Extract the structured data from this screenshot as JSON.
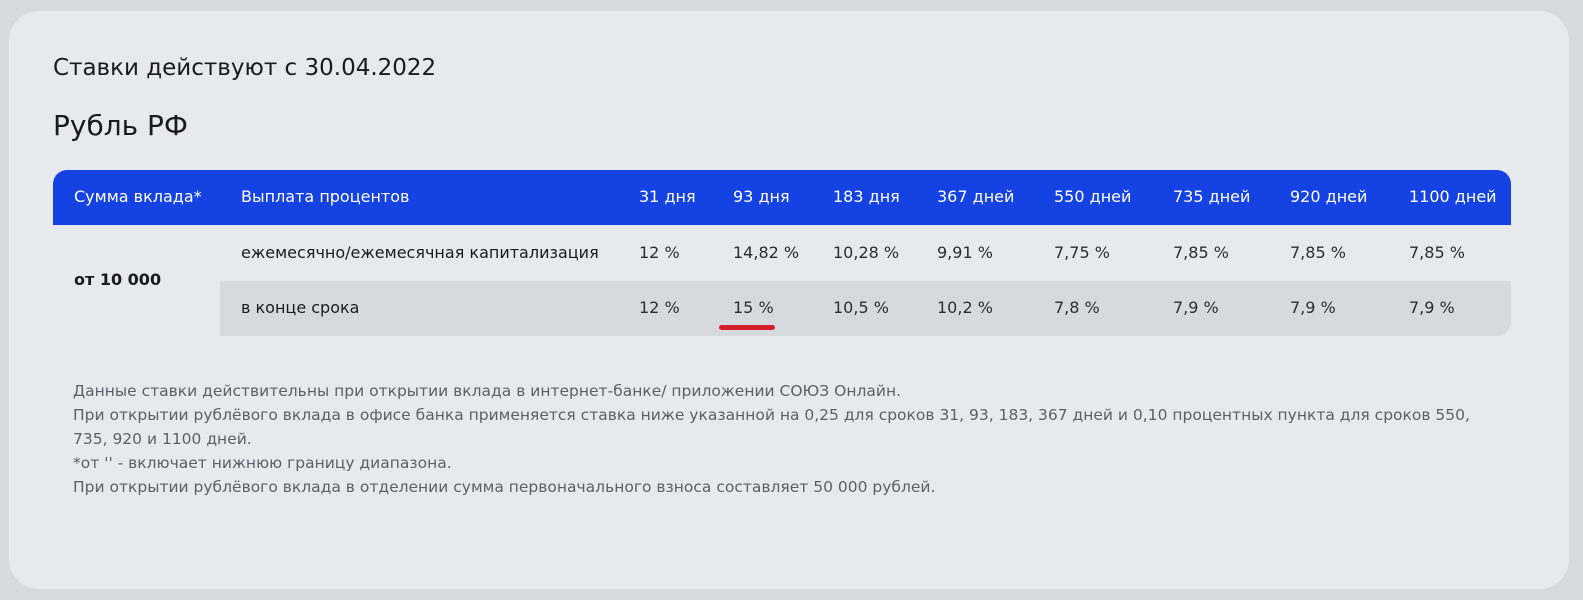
{
  "dates_title": "Ставки действуют с 30.04.2022",
  "currency_title": "Рубль РФ",
  "table": {
    "headers": {
      "sum": "Сумма вклада*",
      "payout": "Выплата процентов",
      "terms": [
        "31 дня",
        "93 дня",
        "183 дня",
        "367 дней",
        "550 дней",
        "735 дней",
        "920 дней",
        "1100 дней"
      ]
    },
    "sum_label": "от 10 000",
    "rows": [
      {
        "payout": "ежемесячно/ежемесячная капитализация",
        "rates": [
          "12 %",
          "14,82 %",
          "10,28 %",
          "9,91 %",
          "7,75 %",
          "7,85 %",
          "7,85 %",
          "7,85 %"
        ]
      },
      {
        "payout": "в конце срока",
        "rates": [
          "12 %",
          "15 %",
          "10,5 %",
          "10,2 %",
          "7,8 %",
          "7,9 %",
          "7,9 %",
          "7,9 %"
        ]
      }
    ]
  },
  "notes": [
    "Данные ставки действительны при открытии вклада в интернет-банке/ приложении СОЮЗ Онлайн.",
    "При открытии рублёвого вклада в офисе банка применяется ставка ниже указанной на 0,25 для сроков 31, 93, 183, 367 дней и 0,10 процентных пункта для сроков 550, 735, 920 и 1100 дней.",
    "*от '' - включает нижнюю границу диапазона.",
    "При открытии рублёвого вклада в отделении сумма первоначального взноса составляет 50 000 рублей."
  ],
  "colors": {
    "header_bg": "#1442e3",
    "highlight_underline": "#d41f2a"
  }
}
